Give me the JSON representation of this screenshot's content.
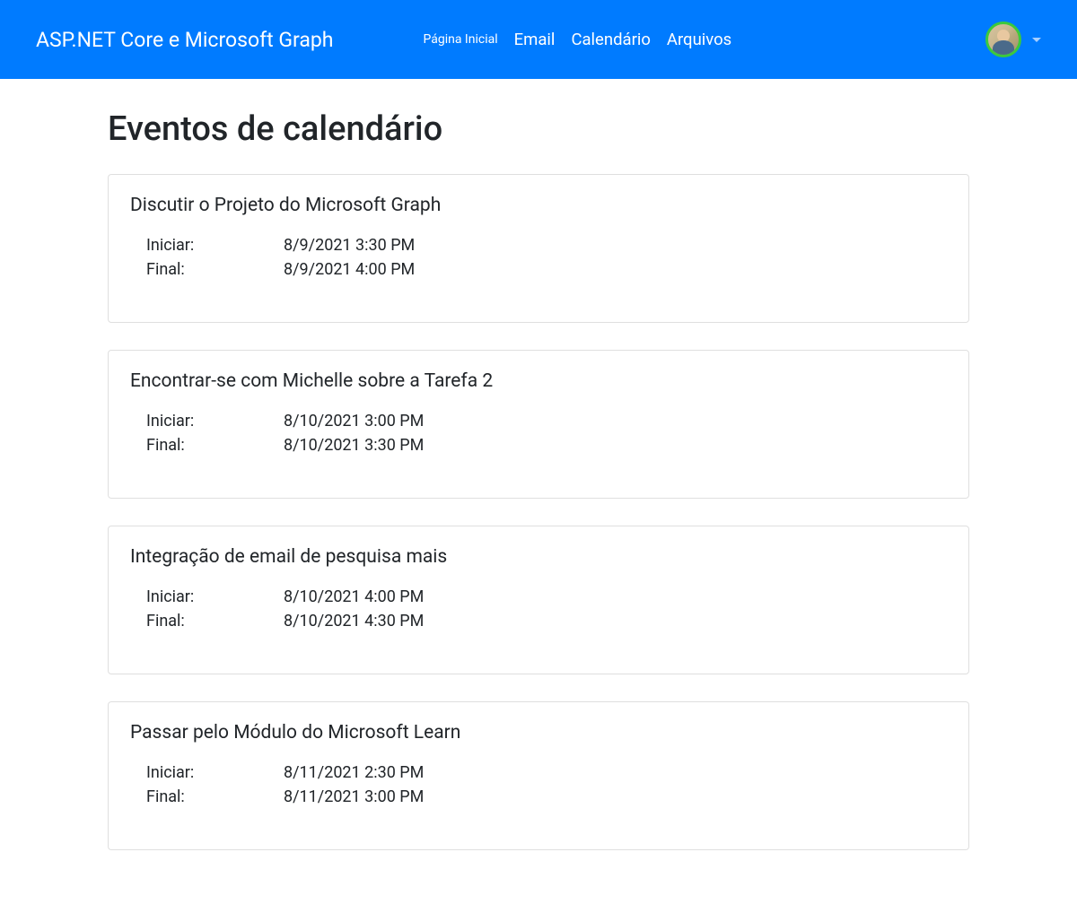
{
  "header": {
    "brand": "ASP.NET Core e Microsoft Graph",
    "nav": {
      "home": "Página Inicial",
      "email": "Email",
      "calendar": "Calendário",
      "files": "Arquivos"
    }
  },
  "page": {
    "title": "Eventos de calendário",
    "start_label": "Iniciar:",
    "end_label": "Final:"
  },
  "events": [
    {
      "title": "Discutir o Projeto do Microsoft Graph",
      "start": "8/9/2021 3:30 PM",
      "end": "8/9/2021 4:00 PM"
    },
    {
      "title": "Encontrar-se com Michelle sobre a Tarefa 2",
      "start": "8/10/2021 3:00 PM",
      "end": "8/10/2021 3:30 PM"
    },
    {
      "title": "Integração de email de pesquisa mais",
      "start": "8/10/2021 4:00 PM",
      "end": "8/10/2021 4:30 PM"
    },
    {
      "title": "Passar pelo Módulo do Microsoft Learn",
      "start": "8/11/2021 2:30 PM",
      "end": "8/11/2021 3:00 PM"
    }
  ]
}
